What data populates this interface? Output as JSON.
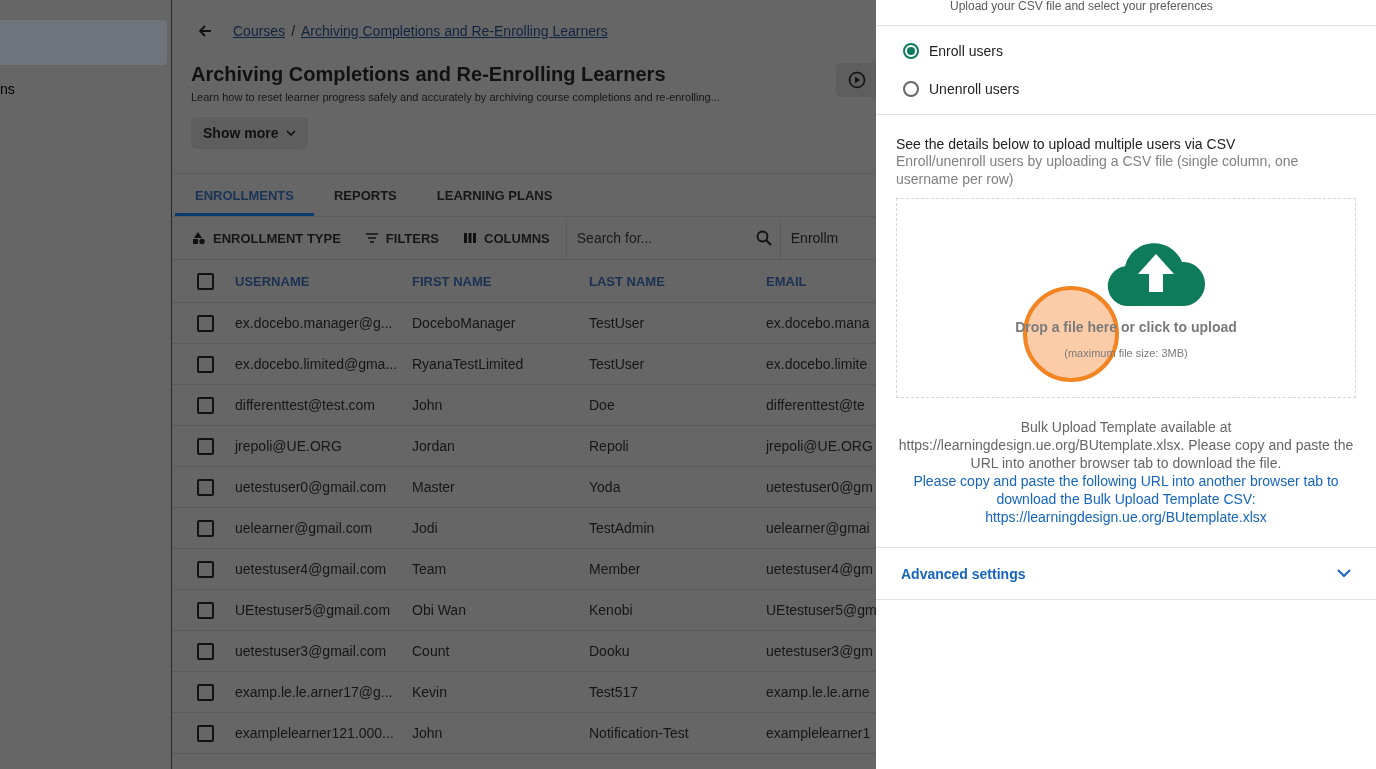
{
  "sidebar": {
    "items": [
      {
        "selected": true
      },
      {
        "label": "ns",
        "selected": false
      }
    ]
  },
  "breadcrumb": {
    "links": [
      "Courses",
      "Archiving Completions and Re-Enrolling Learners"
    ],
    "separator": "/"
  },
  "course": {
    "title": "Archiving Completions and Re-Enrolling Learners",
    "description": "Learn how to reset learner progress safely and accurately by archiving course completions and re-enrolling...",
    "show_more": "Show more"
  },
  "tabs": [
    {
      "label": "ENROLLMENTS",
      "selected": true
    },
    {
      "label": "REPORTS",
      "selected": false
    },
    {
      "label": "LEARNING PLANS",
      "selected": false
    }
  ],
  "toolbar": {
    "buttons": [
      {
        "label": "ENROLLMENT TYPE",
        "kind": "shapes"
      },
      {
        "label": "FILTERS",
        "kind": "filter"
      },
      {
        "label": "COLUMNS",
        "kind": "columns"
      }
    ],
    "search": {
      "placeholder": "Search for..."
    },
    "dropdown": "Enrollm"
  },
  "table": {
    "select_all_checked": false,
    "columns": [
      "USERNAME",
      "FIRST NAME",
      "LAST NAME",
      "EMAIL"
    ],
    "rows": [
      {
        "checked": false,
        "cells": [
          "ex.docebo.manager@g...",
          "DoceboManager",
          "TestUser",
          "ex.docebo.mana"
        ]
      },
      {
        "checked": false,
        "cells": [
          "ex.docebo.limited@gma...",
          "RyanaTestLimited",
          "TestUser",
          "ex.docebo.limite"
        ]
      },
      {
        "checked": false,
        "cells": [
          "differenttest@test.com",
          "John",
          "Doe",
          "differenttest@te"
        ]
      },
      {
        "checked": false,
        "cells": [
          "jrepoli@UE.ORG",
          "Jordan",
          "Repoli",
          "jrepoli@UE.ORG"
        ]
      },
      {
        "checked": false,
        "cells": [
          "uetestuser0@gmail.com",
          "Master",
          "Yoda",
          "uetestuser0@gm"
        ]
      },
      {
        "checked": false,
        "cells": [
          "uelearner@gmail.com",
          "Jodi",
          "TestAdmin",
          "uelearner@gmai"
        ]
      },
      {
        "checked": false,
        "cells": [
          "uetestuser4@gmail.com",
          "Team",
          "Member",
          "uetestuser4@gm"
        ]
      },
      {
        "checked": false,
        "cells": [
          "UEtestuser5@gmail.com",
          "Obi Wan",
          "Kenobi",
          "UEtestuser5@gm"
        ]
      },
      {
        "checked": false,
        "cells": [
          "uetestuser3@gmail.com",
          "Count",
          "Dooku",
          "uetestuser3@gm"
        ]
      },
      {
        "checked": false,
        "cells": [
          "examp.le.le.arner17@g...",
          "Kevin",
          "Test517",
          "examp.le.le.arne"
        ]
      },
      {
        "checked": false,
        "cells": [
          "examplelearner121.000...",
          "John",
          "Notification-Test",
          "examplelearner1"
        ]
      }
    ]
  },
  "panel": {
    "subtitle": "Upload your CSV file and select your preferences",
    "options": [
      {
        "label": "Enroll users",
        "selected": true
      },
      {
        "label": "Unenroll users",
        "selected": false
      }
    ],
    "details_title": "See the details below to upload multiple users via CSV",
    "details_text": "Enroll/unenroll users by uploading a CSV file (single column, one username per row)",
    "dropzone": {
      "title": "Drop a file here or click to upload",
      "note": "(maximum file size: 3MB)",
      "click_highlight": true
    },
    "template_note": "Bulk Upload Template available at https://learningdesign.ue.org/BUtemplate.xlsx. Please copy and paste the URL into another browser tab to download the file.",
    "template_link": "Please copy and paste the following URL into another browser tab to download the Bulk Upload Template CSV: https://learningdesign.ue.org/BUtemplate.xlsx",
    "advanced": {
      "label": "Advanced settings",
      "expanded": false
    }
  }
}
